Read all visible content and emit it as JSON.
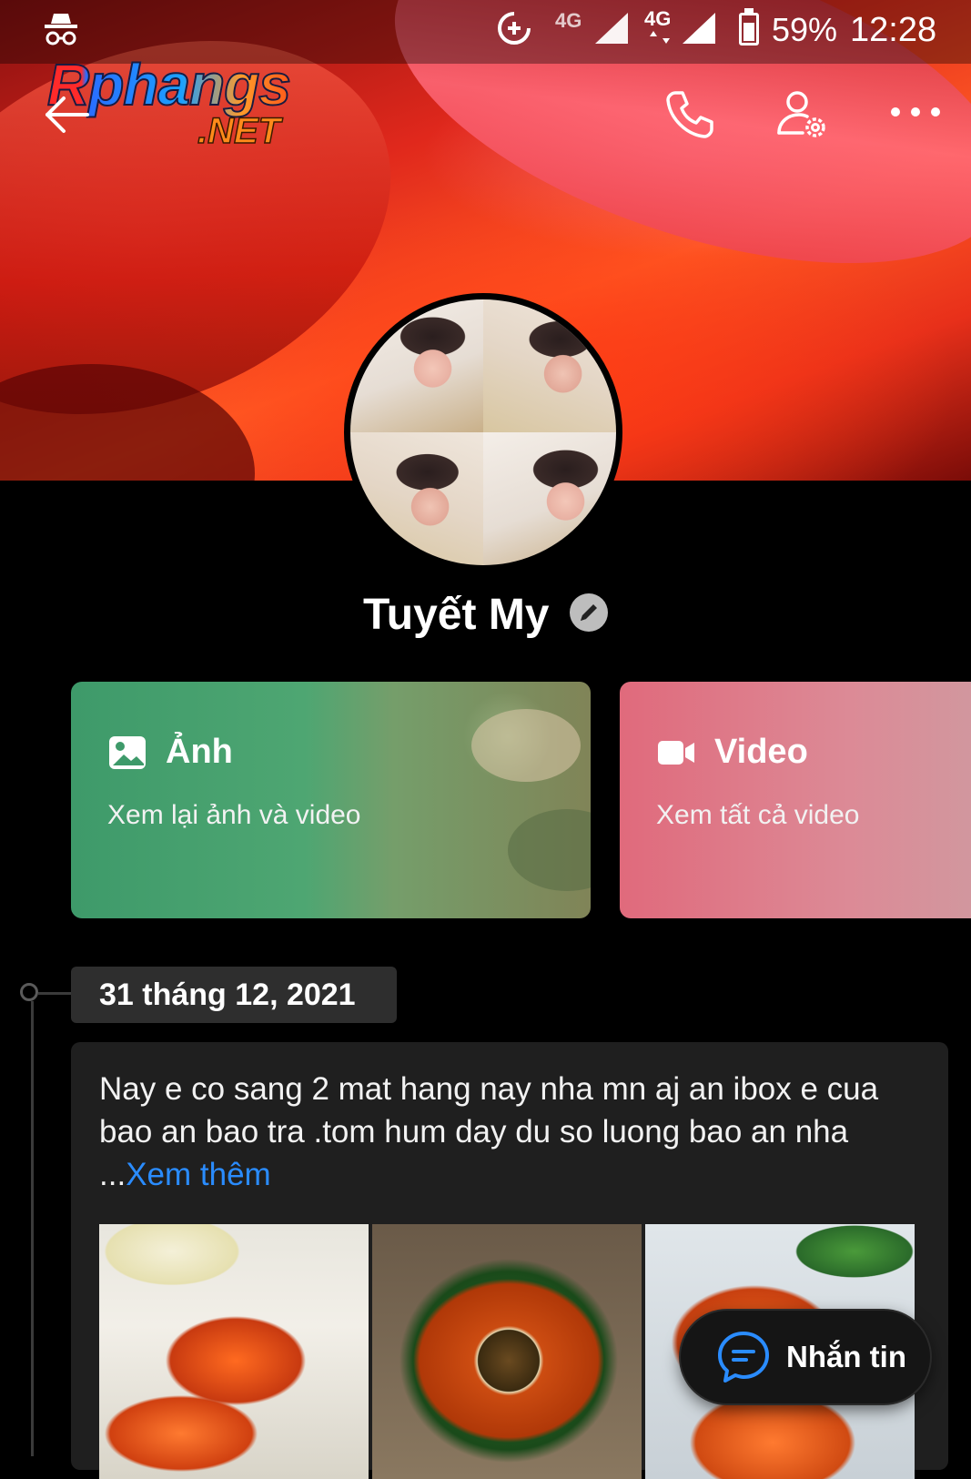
{
  "status_bar": {
    "network_label_1": "4G",
    "network_label_2": "4G",
    "battery_percent": "59%",
    "time": "12:28"
  },
  "watermark": {
    "main": "Rphangs",
    "sub": ".NET"
  },
  "header": {
    "back_icon": "arrow-left-icon",
    "call_icon": "phone-icon",
    "settings_icon": "user-gear-icon",
    "more_icon": "more-dots-icon"
  },
  "profile": {
    "name": "Tuyết My"
  },
  "media_cards": [
    {
      "title": "Ảnh",
      "subtitle": "Xem lại ảnh và video",
      "icon": "image-icon",
      "color": "#3e9a6a"
    },
    {
      "title": "Video",
      "subtitle": "Xem tất cả video",
      "icon": "video-camera-icon",
      "color": "#e06a7c"
    }
  ],
  "timeline": {
    "date": "31 tháng 12, 2021"
  },
  "post": {
    "text": "Nay e co sang 2 mat hang nay nha mn aj an ibox e cua bao an bao tra .tom hum day du so luong bao an nha ...",
    "see_more": "Xem thêm",
    "link_color": "#2a8cff"
  },
  "floating_button": {
    "label": "Nhắn tin",
    "icon": "chat-bubble-icon"
  }
}
